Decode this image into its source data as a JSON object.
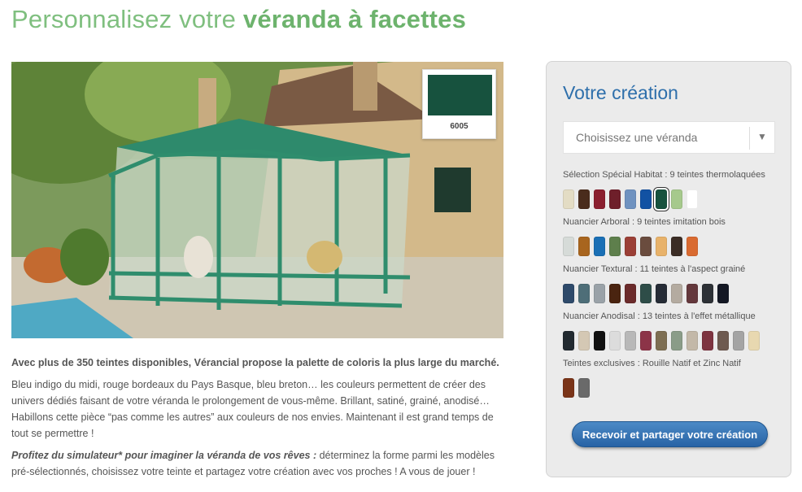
{
  "header": {
    "title_light": "Personnalisez votre",
    "title_bold": "véranda à facettes"
  },
  "selected_color": {
    "code": "6005",
    "hex": "#17523e"
  },
  "intro": {
    "lead": "Avec plus de 350 teintes disponibles, Vérancial propose la palette de coloris la plus large du marché.",
    "body": "Bleu indigo du midi, rouge bordeaux du Pays Basque, bleu breton… les couleurs permettent de créer des univers dédiés faisant de votre véranda le prolongement de vous-même. Brillant, satiné, grainé, anodisé… Habillons cette pièce “pas comme les autres” aux couleurs de nos envies. Maintenant il est grand temps de tout se permettre !",
    "cta_em": "Profitez du simulateur* pour imaginer la véranda de vos rêves :",
    "cta_rest": " déterminez la forme parmi les modèles pré-sélectionnés, choisissez votre teinte et partagez votre création avec vos proches ! A vous de jouer !"
  },
  "panel": {
    "title": "Votre création",
    "select_label": "Choisissez une véranda",
    "groups": [
      {
        "label": "Sélection Spécial Habitat : 9 teintes thermolaquées",
        "colors": [
          "#e3dcc4",
          "#4a2c1c",
          "#8b1f2f",
          "#6e1f2a",
          "#6f92c0",
          "#1252a3",
          "#17523e",
          "#a6c98c",
          "#ffffff"
        ],
        "selected": 6
      },
      {
        "label": "Nuancier Arboral : 9 teintes imitation bois",
        "colors": [
          "#d6dbd8",
          "#a8651e",
          "#1a6fb5",
          "#5e7f4c",
          "#9b3f36",
          "#6a4c3e",
          "#e8b26a",
          "#3b2d25",
          "#d96a30"
        ],
        "selected": -1
      },
      {
        "label": "Nuancier Textural : 11 teintes à l'aspect grainé",
        "colors": [
          "#2e4a6a",
          "#4e6e78",
          "#9aa2a8",
          "#4a2410",
          "#6b2b2b",
          "#2e4d48",
          "#262c36",
          "#b4aba0",
          "#64383c",
          "#2d3136",
          "#141824"
        ],
        "selected": -1
      },
      {
        "label": "Nuancier Anodisal : 13 teintes à l'effet métallique",
        "colors": [
          "#222a30",
          "#d4c8b4",
          "#101010",
          "#dcdcdc",
          "#b8b8b8",
          "#8c3448",
          "#7d6e52",
          "#8a9c88",
          "#c3b8a8",
          "#7e3440",
          "#6e5a50",
          "#a4a4a4",
          "#e8d8b0"
        ],
        "selected": -1
      },
      {
        "label": "Teintes exclusives : Rouille Natif et Zinc Natif",
        "colors": [
          "#7a3418",
          "#6a6a6a"
        ],
        "selected": -1
      }
    ],
    "cta_label": "Recevoir et partager votre création"
  }
}
